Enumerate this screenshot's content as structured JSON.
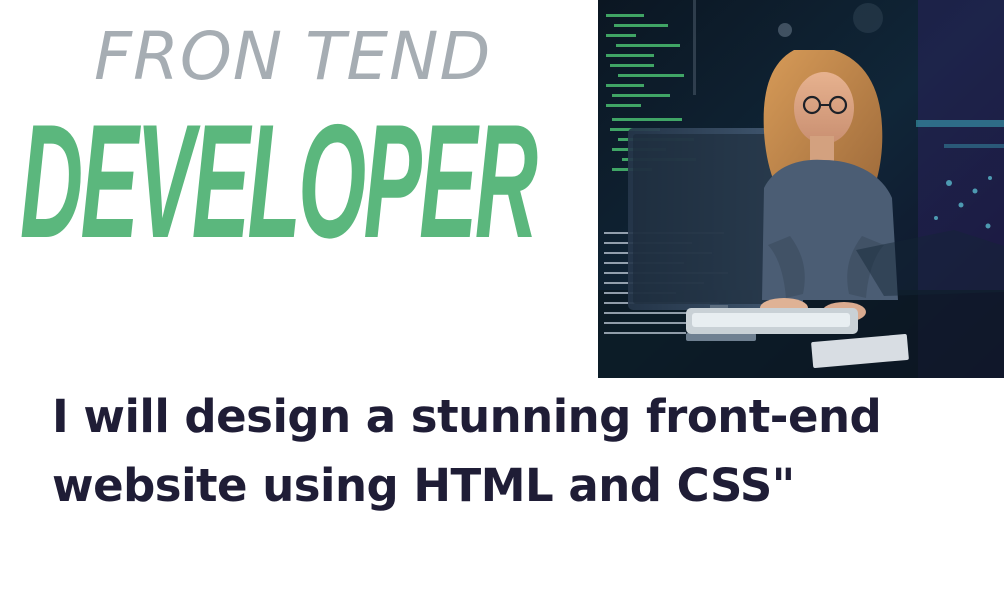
{
  "headline": {
    "top": "FRON TEND",
    "main": "DEVELOPER"
  },
  "subtitle": {
    "line1": "I will design a stunning front-end",
    "line2": "website using HTML and CSS\""
  },
  "colors": {
    "headline_top": "#a6adb3",
    "headline_main": "#5bb77d",
    "subtitle": "#1f1d36"
  },
  "photo": {
    "icon": "developer-photo"
  }
}
